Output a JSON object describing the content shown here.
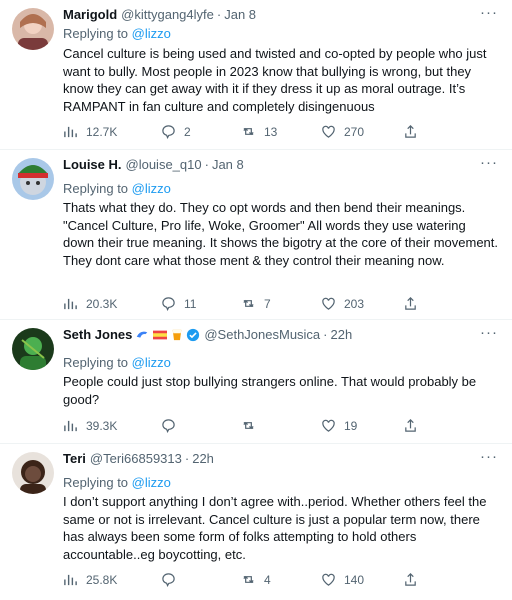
{
  "tweets": [
    {
      "name": "Marigold",
      "handle": "@kittygang4lyfe",
      "time": "Jan 8",
      "replying_label": "Replying to",
      "reply_to": "@lizzo",
      "text": "Cancel culture is being used and twisted and co-opted by people who just want to bully. Most people in 2023 know that bullying is wrong, but they know they can get away with it if they dress it up as moral outrage. It’s RAMPANT in fan culture and completely disingenuous",
      "stats": {
        "views": "12.7K",
        "replies": "2",
        "retweets": "13",
        "likes": "270"
      }
    },
    {
      "name": "Louise H.",
      "handle": "@louise_q10",
      "time": "Jan 8",
      "replying_label": "Replying to",
      "reply_to": "@lizzo",
      "text": "Thats what they do. They co opt words and then bend their meanings. \"Cancel Culture, Pro life, Woke, Groomer\" All words they use watering down their true meaning. It shows the bigotry at the core of their movement. They dont care what those ment & they control their meaning now.",
      "stats": {
        "views": "20.3K",
        "replies": "11",
        "retweets": "7",
        "likes": "203"
      }
    },
    {
      "name": "Seth Jones",
      "handle": "@SethJonesMusica",
      "time": "22h",
      "replying_label": "Replying to",
      "reply_to": "@lizzo",
      "text": "People could just stop bullying strangers online. That would probably be good?",
      "stats": {
        "views": "39.3K",
        "replies": "",
        "retweets": "",
        "likes": "19"
      }
    },
    {
      "name": "Teri",
      "handle": "@Teri66859313",
      "time": "22h",
      "replying_label": "Replying to",
      "reply_to": "@lizzo",
      "text": "I don’t support anything I don’t agree with..period.  Whether others feel the same or not is irrelevant.    Cancel culture is just a popular term now, there has always been some form of folks attempting to hold others accountable..eg boycotting, etc.",
      "stats": {
        "views": "25.8K",
        "replies": "",
        "retweets": "4",
        "likes": "140"
      }
    }
  ],
  "ui": {
    "more_label": "···",
    "dot": "·"
  },
  "colors": {
    "accent": "#1d9bf0",
    "muted": "#536471",
    "text": "#0f1419",
    "divider": "#eff3f4"
  },
  "icons": [
    "views-icon",
    "reply-icon",
    "retweet-icon",
    "like-icon",
    "share-icon",
    "more-icon",
    "verified-icon",
    "dolphin-emoji-icon",
    "flag-emoji-icon",
    "drink-emoji-icon"
  ]
}
